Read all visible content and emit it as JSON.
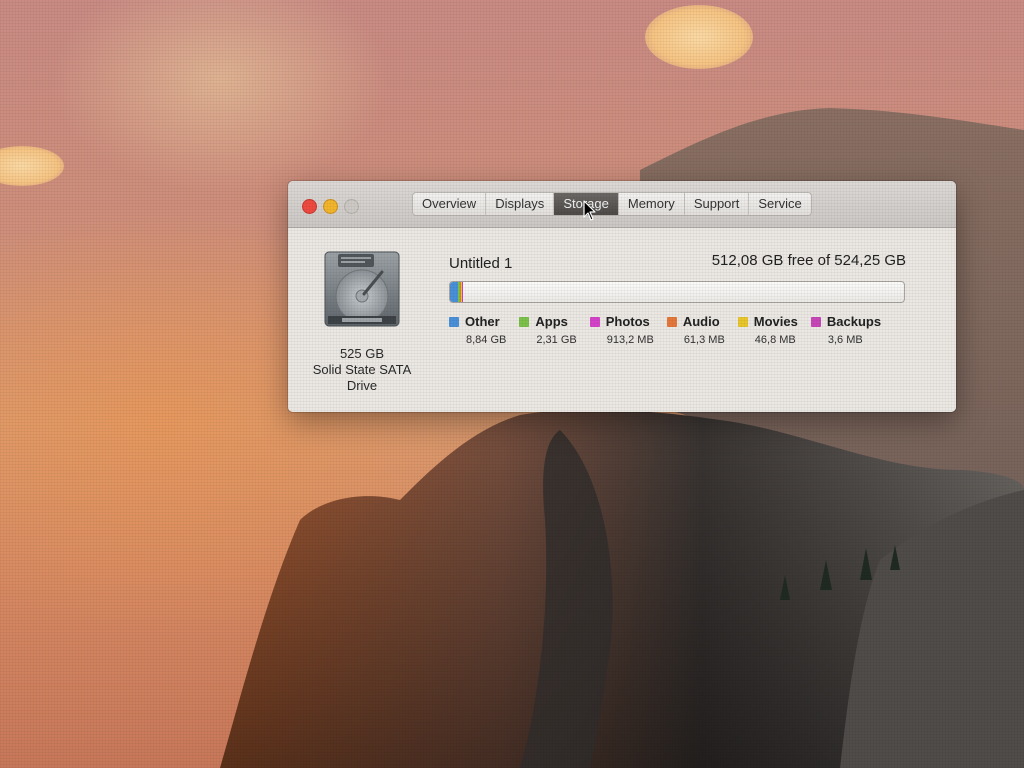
{
  "window": {
    "tabs": [
      {
        "label": "Overview",
        "active": false
      },
      {
        "label": "Displays",
        "active": false
      },
      {
        "label": "Storage",
        "active": true
      },
      {
        "label": "Memory",
        "active": false
      },
      {
        "label": "Support",
        "active": false
      },
      {
        "label": "Service",
        "active": false
      }
    ]
  },
  "drive": {
    "icon": "hard-drive-icon",
    "capacity": "525 GB",
    "type_line1": "Solid State SATA",
    "type_line2": "Drive"
  },
  "volume": {
    "name": "Untitled 1",
    "free_text": "512,08 GB free of 524,25 GB",
    "total_gb": 524.25,
    "free_gb": 512.08
  },
  "categories": [
    {
      "name": "Other",
      "size": "8,84 GB",
      "gb": 8.84,
      "color": "#4a90d9"
    },
    {
      "name": "Apps",
      "size": "2,31 GB",
      "gb": 2.31,
      "color": "#7cc14a"
    },
    {
      "name": "Photos",
      "size": "913,2 MB",
      "gb": 0.9132,
      "color": "#d444c8"
    },
    {
      "name": "Audio",
      "size": "61,3 MB",
      "gb": 0.0613,
      "color": "#e4783b"
    },
    {
      "name": "Movies",
      "size": "46,8 MB",
      "gb": 0.0468,
      "color": "#e8c62c"
    },
    {
      "name": "Backups",
      "size": "3,6 MB",
      "gb": 0.0036,
      "color": "#c746b8"
    }
  ],
  "traffic_lights": {
    "close_color": "#ee4a40",
    "minimize_color": "#f2b52c",
    "zoom_color": "#cdcac6"
  }
}
